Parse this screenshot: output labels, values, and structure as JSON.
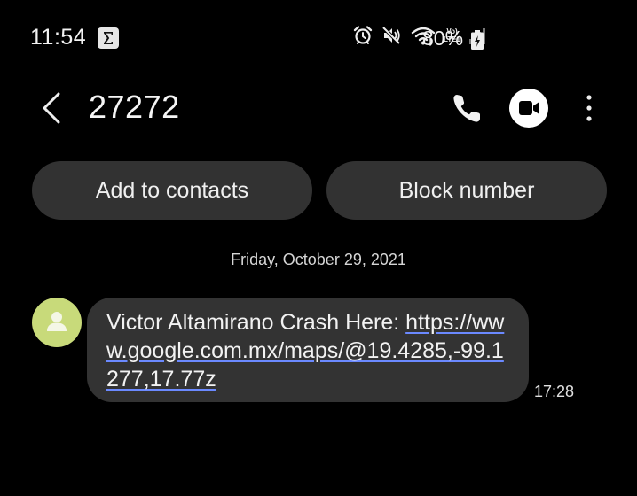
{
  "status_bar": {
    "time": "11:54",
    "notification_icon": "sigma-icon",
    "icons": [
      "alarm-icon",
      "mute-icon",
      "wifi-icon",
      "volte-lte-icon",
      "signal-icon"
    ],
    "volte_label": "Vo)",
    "lte_label": "LTE1",
    "battery": "80%",
    "battery_icon": "battery-charging-icon"
  },
  "header": {
    "back_icon": "back-chevron-icon",
    "title": "27272",
    "call_icon": "phone-icon",
    "video_icon": "video-call-icon",
    "more_icon": "more-vertical-icon"
  },
  "actions": {
    "add_to_contacts": "Add to contacts",
    "block_number": "Block number"
  },
  "conversation": {
    "date": "Friday, October 29, 2021",
    "message": {
      "avatar_icon": "person-icon",
      "prefix": "Victor Altamirano Crash Here: ",
      "link": "https://www.google.com.mx/maps/@19.4285,-99.1277,17.77z",
      "time": "17:28"
    }
  },
  "colors": {
    "background": "#000000",
    "pill": "#323232",
    "bubble": "#333333",
    "avatar": "#c8da7a",
    "link_underline": "#6b89ff"
  }
}
